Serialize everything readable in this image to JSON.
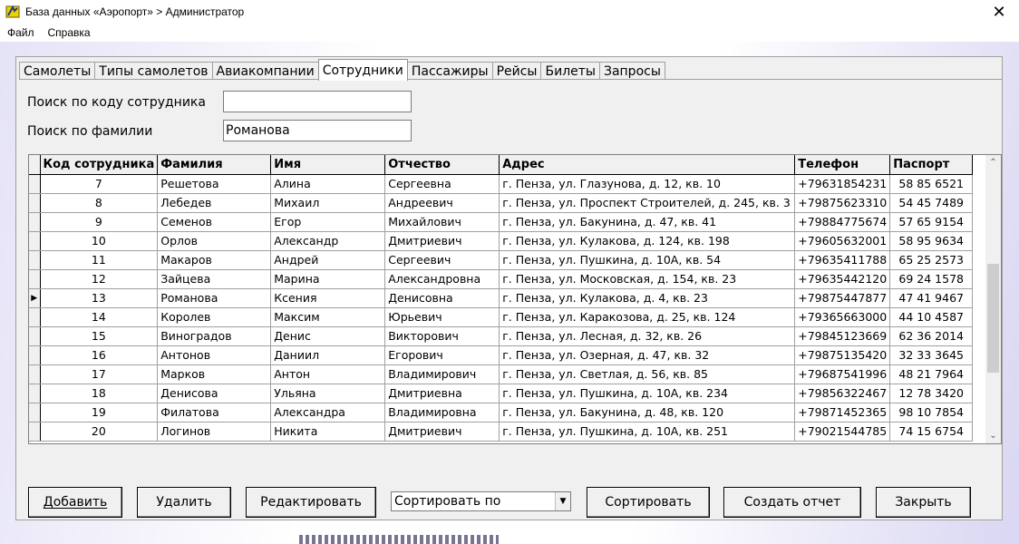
{
  "window": {
    "title": "База данных «Аэропорт» > Администратор",
    "close_glyph": "✕"
  },
  "menu": [
    "Файл",
    "Справка"
  ],
  "tabs": [
    "Самолеты",
    "Типы самолетов",
    "Авиакомпании",
    "Сотрудники",
    "Пассажиры",
    "Рейсы",
    "Билеты",
    "Запросы"
  ],
  "active_tab": "Сотрудники",
  "search": {
    "by_code_label": "Поиск по коду сотрудника",
    "by_code_value": "",
    "by_surname_label": "Поиск по фамилии",
    "by_surname_value": "Романова"
  },
  "grid": {
    "columns": [
      "Код сотрудника",
      "Фамилия",
      "Имя",
      "Отчество",
      "Адрес",
      "Телефон",
      "Паспорт"
    ],
    "current_row_marker": "▶",
    "current_row_index": 6,
    "rows": [
      [
        "7",
        "Решетова",
        "Алина",
        "Сергеевна",
        "г. Пенза, ул. Глазунова, д. 12, кв. 10",
        "+79631854231",
        "58 85 6521"
      ],
      [
        "8",
        "Лебедев",
        "Михаил",
        "Андреевич",
        "г. Пенза, ул. Проспект Строителей, д. 245, кв. 3",
        "+79875623310",
        "54 45 7489"
      ],
      [
        "9",
        "Семенов",
        "Егор",
        "Михайлович",
        "г. Пенза, ул. Бакунина, д. 47, кв. 41",
        "+79884775674",
        "57 65 9154"
      ],
      [
        "10",
        "Орлов",
        "Александр",
        "Дмитриевич",
        "г. Пенза, ул. Кулакова, д. 124, кв. 198",
        "+79605632001",
        "58 95 9634"
      ],
      [
        "11",
        "Макаров",
        "Андрей",
        "Сергеевич",
        "г. Пенза, ул. Пушкина, д. 10А, кв. 54",
        "+79635411788",
        "65 25 2573"
      ],
      [
        "12",
        "Зайцева",
        "Марина",
        "Александровна",
        "г. Пенза, ул. Московская, д. 154, кв. 23",
        "+79635442120",
        "69 24 1578"
      ],
      [
        "13",
        "Романова",
        "Ксения",
        "Денисовна",
        "г. Пенза, ул. Кулакова, д. 4, кв. 23",
        "+79875447877",
        "47 41 9467"
      ],
      [
        "14",
        "Королев",
        "Максим",
        "Юрьевич",
        "г. Пенза, ул. Каракозова, д. 25, кв. 124",
        "+79365663000",
        "44 10 4587"
      ],
      [
        "15",
        "Виноградов",
        "Денис",
        "Викторович",
        "г. Пенза, ул. Лесная, д. 32, кв. 26",
        "+79845123669",
        "62 36 2014"
      ],
      [
        "16",
        "Антонов",
        "Даниил",
        "Егорович",
        "г. Пенза, ул. Озерная, д. 47, кв. 32",
        "+79875135420",
        "32 33 3645"
      ],
      [
        "17",
        "Марков",
        "Антон",
        "Владимирович",
        "г. Пенза, ул. Светлая, д. 56, кв. 85",
        "+79687541996",
        "48 21 7964"
      ],
      [
        "18",
        "Денисова",
        "Ульяна",
        "Дмитриевна",
        "г. Пенза, ул. Пушкина, д. 10А, кв. 234",
        "+79856322467",
        "12 78 3420"
      ],
      [
        "19",
        "Филатова",
        "Александра",
        "Владимировна",
        "г. Пенза, ул. Бакунина, д. 48, кв. 120",
        "+79871452365",
        "98 10 7854"
      ],
      [
        "20",
        "Логинов",
        "Никита",
        "Дмитриевич",
        "г. Пенза, ул. Пушкина, д. 10А, кв. 251",
        "+79021544785",
        "74 15 6754"
      ]
    ]
  },
  "buttons": {
    "add": "Добавить",
    "delete": "Удалить",
    "edit": "Редактировать",
    "sort": "Сортировать",
    "report": "Создать отчет",
    "close": "Закрыть"
  },
  "sort_select": {
    "value": "Сортировать по"
  }
}
